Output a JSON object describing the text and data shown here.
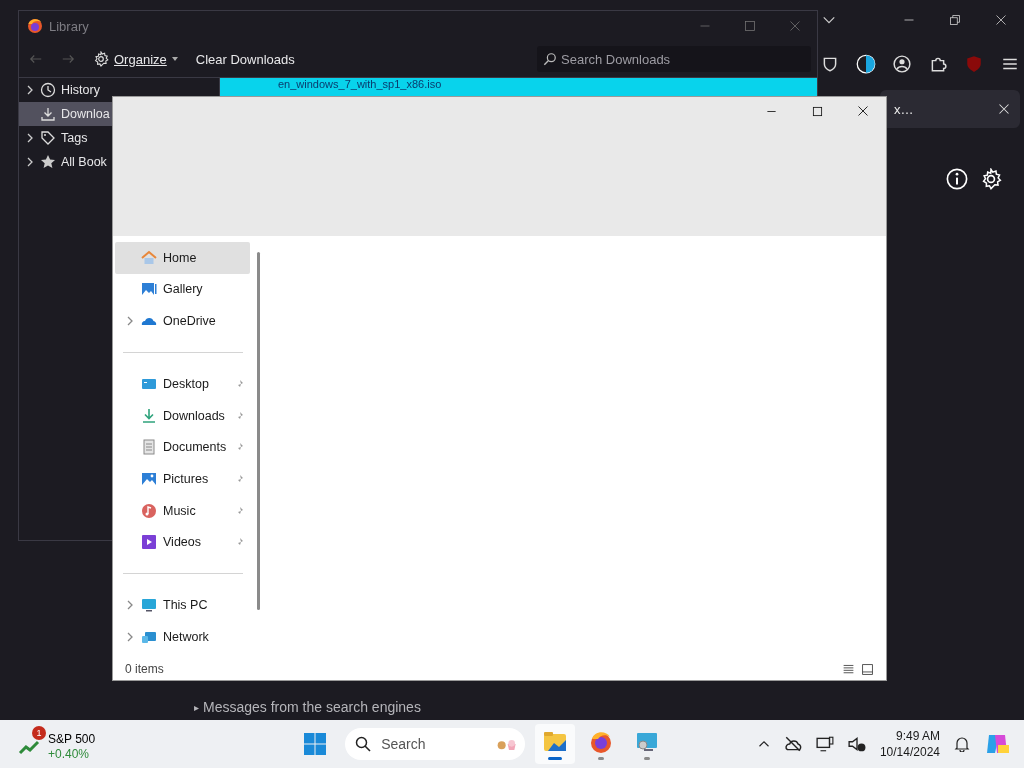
{
  "browser": {
    "notification_text": "x…",
    "footer_marker": "▸",
    "footer_text": "Messages from the search engines"
  },
  "library": {
    "title": "Library",
    "organize": "Organize",
    "clear": "Clear Downloads",
    "search_placeholder": "Search Downloads",
    "sidebar": [
      {
        "kind": "history",
        "label": "History",
        "expandable": true,
        "selected": false
      },
      {
        "kind": "downloads",
        "label": "Downloa",
        "expandable": false,
        "selected": true
      },
      {
        "kind": "tags",
        "label": "Tags",
        "expandable": true,
        "selected": false
      },
      {
        "kind": "bookmarks",
        "label": "All Book",
        "expandable": true,
        "selected": false
      }
    ],
    "downloads": [
      {
        "name": "en_windows_7_with_sp1_x86.iso",
        "selected": true
      }
    ]
  },
  "explorer": {
    "nav_groups": [
      [
        {
          "kind": "home",
          "label": "Home",
          "expandable": false,
          "pinned": false,
          "selected": true
        },
        {
          "kind": "gallery",
          "label": "Gallery",
          "expandable": false,
          "pinned": false,
          "selected": false
        },
        {
          "kind": "cloud",
          "label": "OneDrive",
          "expandable": true,
          "pinned": false,
          "selected": false
        }
      ],
      [
        {
          "kind": "desktop",
          "label": "Desktop",
          "expandable": false,
          "pinned": true,
          "selected": false
        },
        {
          "kind": "download",
          "label": "Downloads",
          "expandable": false,
          "pinned": true,
          "selected": false
        },
        {
          "kind": "document",
          "label": "Documents",
          "expandable": false,
          "pinned": true,
          "selected": false
        },
        {
          "kind": "pictures",
          "label": "Pictures",
          "expandable": false,
          "pinned": true,
          "selected": false
        },
        {
          "kind": "music",
          "label": "Music",
          "expandable": false,
          "pinned": true,
          "selected": false
        },
        {
          "kind": "videos",
          "label": "Videos",
          "expandable": false,
          "pinned": true,
          "selected": false
        }
      ],
      [
        {
          "kind": "pc",
          "label": "This PC",
          "expandable": true,
          "pinned": false,
          "selected": false
        },
        {
          "kind": "network",
          "label": "Network",
          "expandable": true,
          "pinned": false,
          "selected": false
        }
      ]
    ],
    "status": "0 items"
  },
  "taskbar": {
    "widget": {
      "badge": "1",
      "title": "S&P 500",
      "change": "+0.40%"
    },
    "search_placeholder": "Search",
    "apps": [
      {
        "kind": "explorer",
        "selected": true
      },
      {
        "kind": "firefox",
        "selected": false
      },
      {
        "kind": "remote",
        "selected": false
      }
    ],
    "time": "9:49 AM",
    "date": "10/14/2024"
  }
}
